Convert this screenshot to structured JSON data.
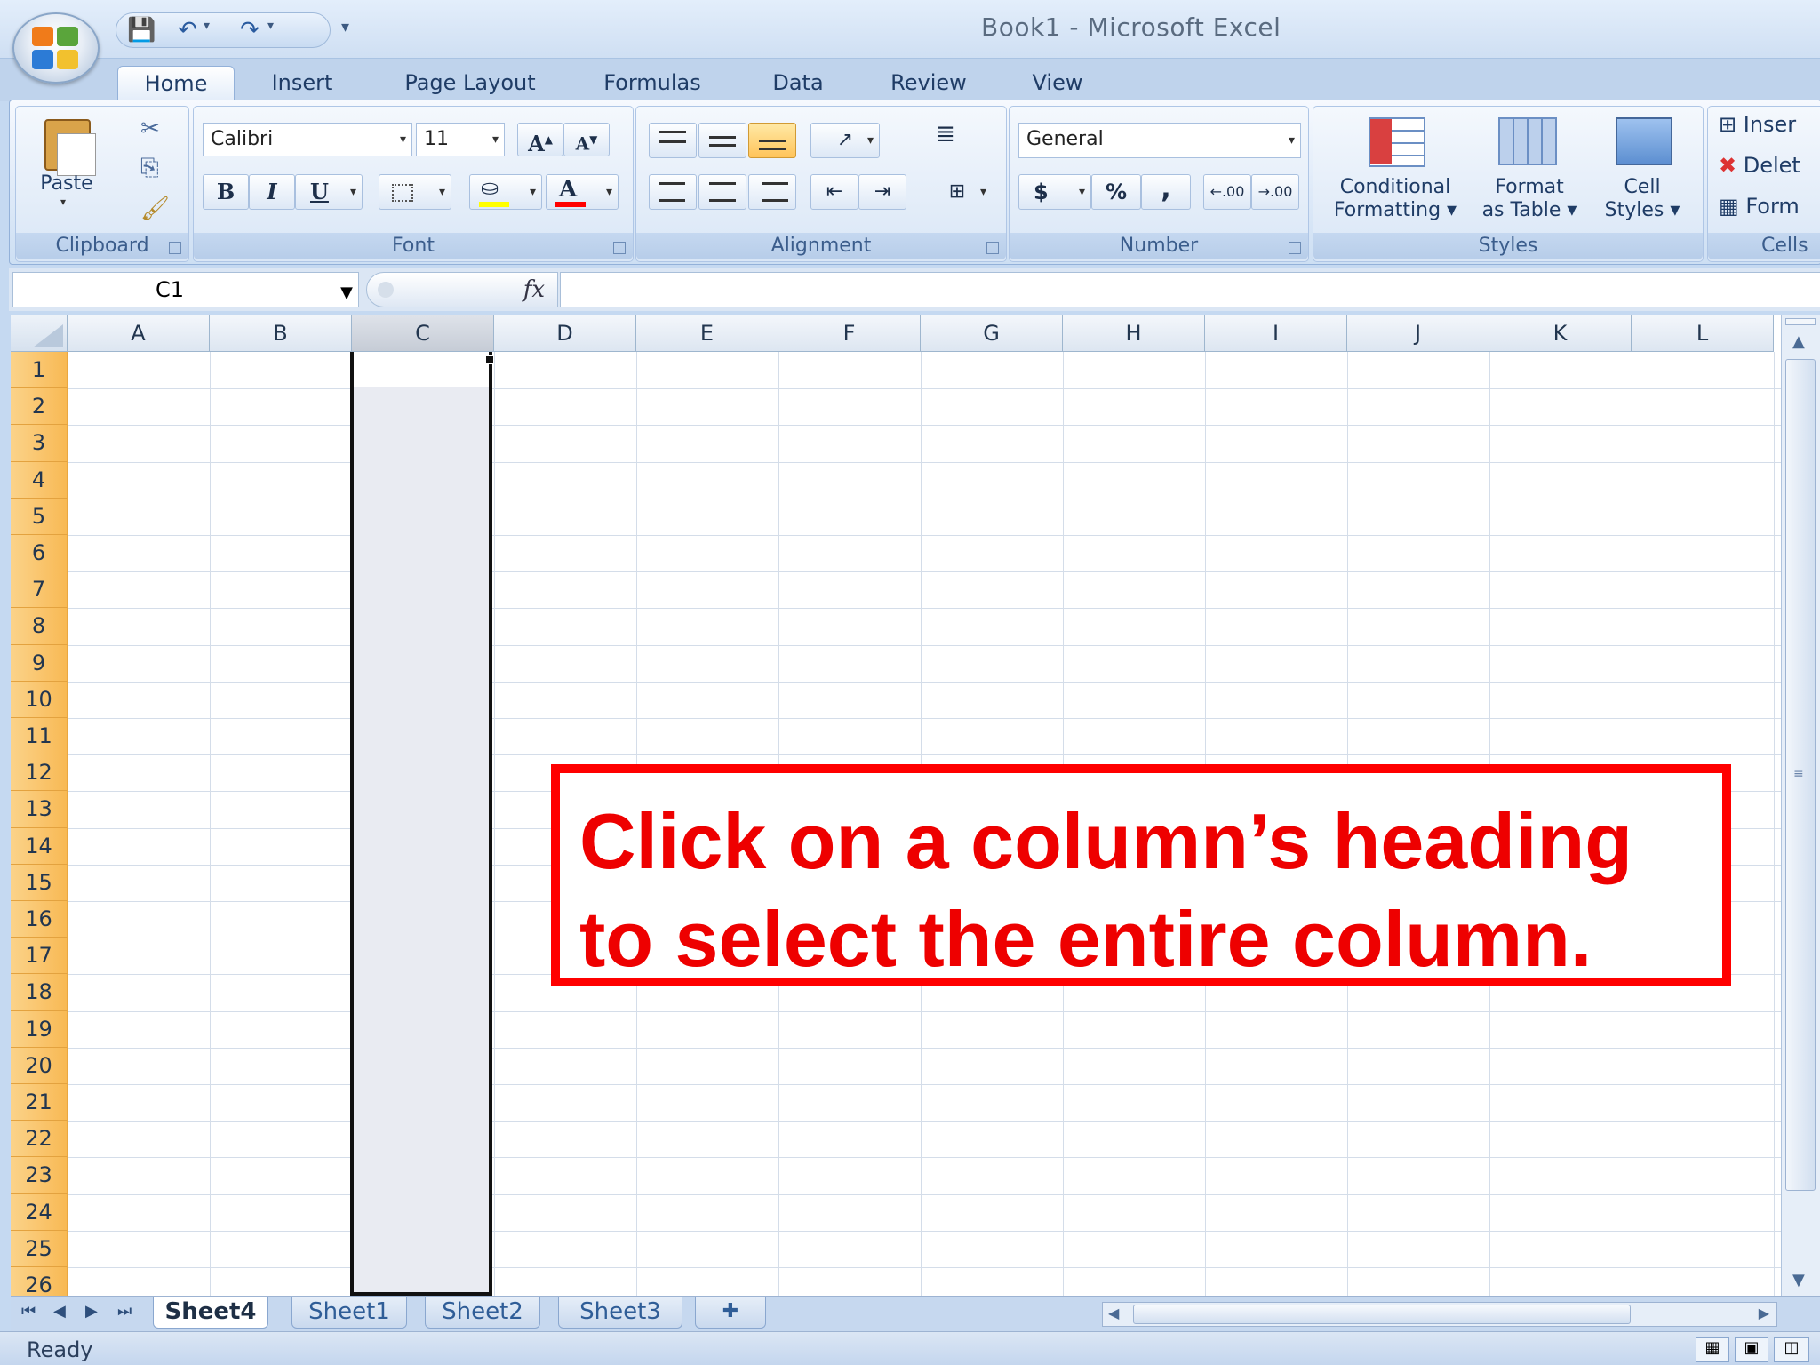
{
  "window": {
    "title": "Book1 - Microsoft Excel"
  },
  "quick_access": {
    "items": [
      "save-icon",
      "undo-icon",
      "redo-icon",
      "customize-icon"
    ]
  },
  "tabs": [
    "Home",
    "Insert",
    "Page Layout",
    "Formulas",
    "Data",
    "Review",
    "View"
  ],
  "active_tab": "Home",
  "ribbon": {
    "clipboard": {
      "label": "Clipboard",
      "paste": "Paste"
    },
    "font": {
      "label": "Font",
      "family": "Calibri",
      "size": "11",
      "bold": "B",
      "italic": "I",
      "underline": "U",
      "grow": "A",
      "shrink": "A",
      "color": "A"
    },
    "alignment": {
      "label": "Alignment"
    },
    "number": {
      "label": "Number",
      "format": "General",
      "currency": "$",
      "percent": "%",
      "comma": ",",
      "inc_dec": ".00",
      "dec_dec": ".00"
    },
    "styles": {
      "label": "Styles",
      "conditional_1": "Conditional",
      "conditional_2": "Formatting",
      "format_table_1": "Format",
      "format_table_2": "as Table",
      "cell_styles_1": "Cell",
      "cell_styles_2": "Styles"
    },
    "cells": {
      "label": "Cells",
      "insert": "Inser",
      "delete": "Delet",
      "format": "Form"
    }
  },
  "formula_bar": {
    "name_box": "C1",
    "fx": "fx",
    "formula": ""
  },
  "grid": {
    "columns": [
      "A",
      "B",
      "C",
      "D",
      "E",
      "F",
      "G",
      "H",
      "I",
      "J",
      "K",
      "L"
    ],
    "rows": [
      "1",
      "2",
      "3",
      "4",
      "5",
      "6",
      "7",
      "8",
      "9",
      "10",
      "11",
      "12",
      "13",
      "14",
      "15",
      "16",
      "17",
      "18",
      "19",
      "20",
      "21",
      "22",
      "23",
      "24",
      "25",
      "26"
    ],
    "selected_column": "C"
  },
  "callout": {
    "line1": "Click on a column’s heading",
    "line2": "to select the entire column."
  },
  "sheets": [
    {
      "name": "Sheet4",
      "active": true
    },
    {
      "name": "Sheet1",
      "active": false
    },
    {
      "name": "Sheet2",
      "active": false
    },
    {
      "name": "Sheet3",
      "active": false
    }
  ],
  "status": {
    "text": "Ready"
  }
}
